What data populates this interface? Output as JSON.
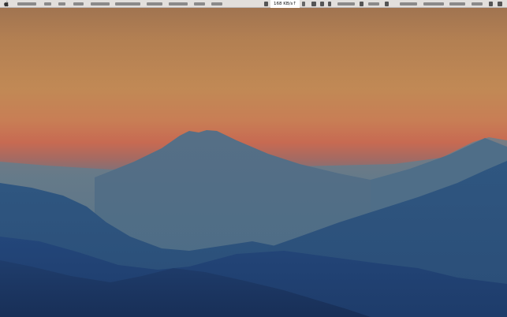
{
  "menubar": {
    "apple_icon": "apple-icon",
    "network_speed": "168 KB/s↑",
    "status_icons": [
      "net-activity-icon",
      "wifi-icon",
      "display-icon",
      "volume-icon",
      "bluetooth-icon",
      "battery-icon",
      "clock-icon",
      "spotlight-icon",
      "notification-icon"
    ]
  },
  "colors": {
    "sky_top": "#b27f52",
    "sky_mid": "#c58a57",
    "horizon_glow": "#c76a52",
    "haze": "#5f7a8a",
    "volcano": "#55728a",
    "ridge_far": "#3e6384",
    "ridge_mid": "#28497a",
    "ridge_near": "#1f3a66"
  }
}
